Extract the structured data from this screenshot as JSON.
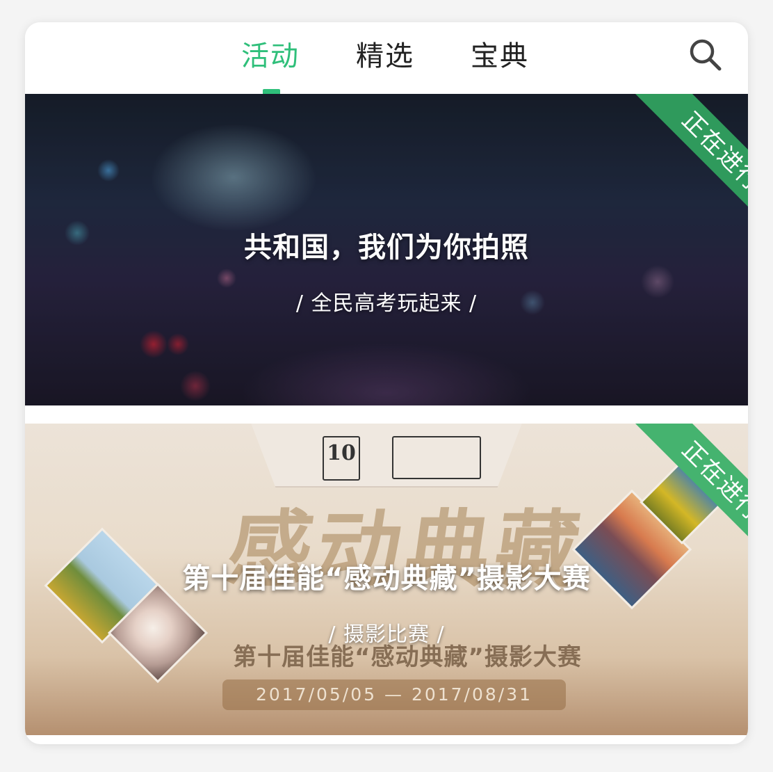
{
  "header": {
    "tabs": [
      {
        "label": "活动",
        "active": true
      },
      {
        "label": "精选",
        "active": false
      },
      {
        "label": "宝典",
        "active": false
      }
    ],
    "search_icon": "search-icon",
    "accent_color": "#2fbf7a"
  },
  "banners": [
    {
      "title": "共和国，我们为你拍照",
      "subtitle": "/ 全民高考玩起来 /",
      "status": "正在进行"
    },
    {
      "title": "第十届佳能“感动典藏”摄影大赛",
      "subtitle": "/ 摄影比赛 /",
      "status": "正在进行",
      "poster": {
        "anniversary_logo": "10",
        "brush_title": "感动典藏",
        "line": "第十届佳能“感动典藏”摄影大赛",
        "date_range": "2017/05/05 — 2017/08/31"
      }
    }
  ],
  "status_color": "#2f9a5c"
}
